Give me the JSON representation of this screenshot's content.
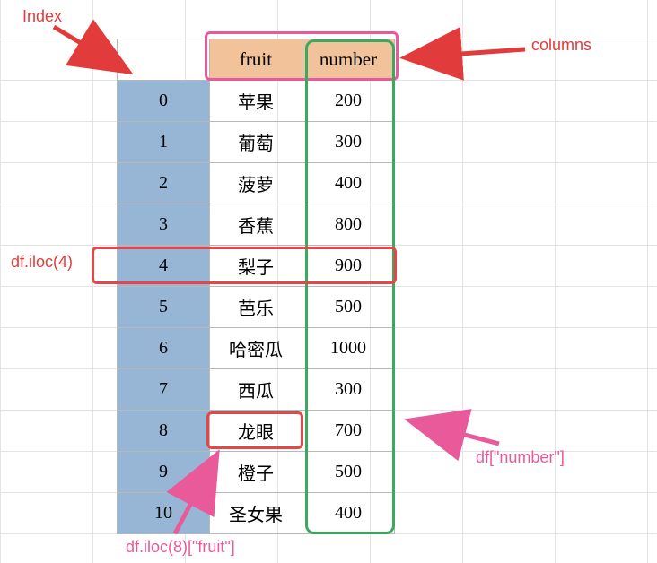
{
  "columns": {
    "c0": "fruit",
    "c1": "number"
  },
  "rows": [
    {
      "idx": "0",
      "fruit": "苹果",
      "number": "200"
    },
    {
      "idx": "1",
      "fruit": "葡萄",
      "number": "300"
    },
    {
      "idx": "2",
      "fruit": "菠萝",
      "number": "400"
    },
    {
      "idx": "3",
      "fruit": "香蕉",
      "number": "800"
    },
    {
      "idx": "4",
      "fruit": "梨子",
      "number": "900"
    },
    {
      "idx": "5",
      "fruit": "芭乐",
      "number": "500"
    },
    {
      "idx": "6",
      "fruit": "哈密瓜",
      "number": "1000"
    },
    {
      "idx": "7",
      "fruit": "西瓜",
      "number": "300"
    },
    {
      "idx": "8",
      "fruit": "龙眼",
      "number": "700"
    },
    {
      "idx": "9",
      "fruit": "橙子",
      "number": "500"
    },
    {
      "idx": "10",
      "fruit": "圣女果",
      "number": "400"
    }
  ],
  "labels": {
    "index": "Index",
    "columns": "columns",
    "iloc4": "df.iloc(4)",
    "dfnumber": "df[\"number\"]",
    "iloc8fruit": "df.iloc(8)[\"fruit\"]"
  }
}
